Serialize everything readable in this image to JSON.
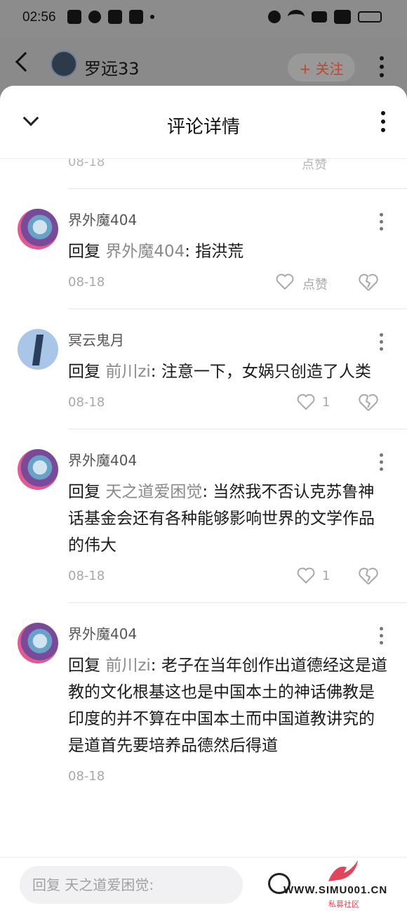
{
  "status_bar": {
    "time": "02:56",
    "icons": [
      "mail-icon",
      "qq-icon",
      "baidu-icon",
      "browser-icon",
      "alarm-icon",
      "wifi-icon",
      "hd-icon",
      "signal-5g-icon",
      "battery-icon"
    ]
  },
  "page_header": {
    "user_name": "罗远33",
    "follow_label": "+ 关注"
  },
  "sheet": {
    "title": "评论详情"
  },
  "partial_item": {
    "date": "08-18",
    "like_label": "点赞"
  },
  "comments": [
    {
      "name": "界外魔404",
      "reply_word": "回复",
      "target": "界外魔404",
      "text": ": 指洪荒",
      "date": "08-18",
      "likes": "点赞"
    },
    {
      "name": "冥云鬼月",
      "reply_word": "回复",
      "target": "前川zi",
      "text": ": 注意一下，女娲只创造了人类",
      "date": "08-18",
      "likes": "1"
    },
    {
      "name": "界外魔404",
      "reply_word": "回复",
      "target": "天之道爱困觉",
      "text": ": 当然我不否认克苏鲁神话基金会还有各种能够影响世界的文学作品的伟大",
      "date": "08-18",
      "likes": "1"
    },
    {
      "name": "界外魔404",
      "reply_word": "回复",
      "target": "前川zi",
      "text": ": 老子在当年创作出道德经这是道教的文化根基这也是中国本土的神话佛教是印度的并不算在中国本土而中国道教讲究的是道首先要培养品德然后得道",
      "date": "08-18",
      "likes": ""
    }
  ],
  "reply_bar": {
    "placeholder": "回复 天之道爱困觉:"
  },
  "watermark": {
    "url": "WWW.SIMU001.CN",
    "subtitle": "私募社区"
  },
  "colors": {
    "accent": "#b44a30",
    "muted_text": "#8a8a8a",
    "watermark_red": "#e0465b"
  }
}
